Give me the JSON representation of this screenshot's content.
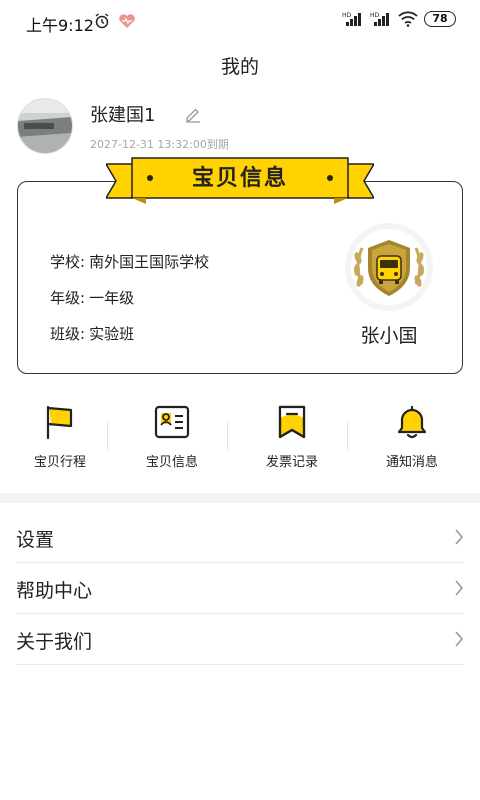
{
  "status_bar": {
    "time": "上午9:12",
    "battery": "78",
    "icons": [
      "alarm-icon",
      "health-heart-icon",
      "hd-signal-icon",
      "hd-signal-icon",
      "wifi-icon",
      "battery-icon"
    ]
  },
  "page": {
    "title": "我的"
  },
  "profile": {
    "name": "张建国1",
    "expire": "2027-12-31 13:32:00到期",
    "edit_icon": "edit-pencil-icon"
  },
  "baby_card": {
    "title": "宝贝信息",
    "school_label": "学校:",
    "school": "南外国王国际学校",
    "grade_label": "年级:",
    "grade": "一年级",
    "class_label": "班级:",
    "class_name": "实验班",
    "child_name": "张小国",
    "badge_icon": "school-bus-badge-icon",
    "accent": "#FFD200"
  },
  "shortcuts": [
    {
      "label": "宝贝行程",
      "icon": "flag-icon"
    },
    {
      "label": "宝贝信息",
      "icon": "id-card-icon"
    },
    {
      "label": "发票记录",
      "icon": "invoice-bookmark-icon"
    },
    {
      "label": "通知消息",
      "icon": "bell-icon"
    }
  ],
  "menu": [
    {
      "label": "设置"
    },
    {
      "label": "帮助中心"
    },
    {
      "label": "关于我们"
    }
  ]
}
